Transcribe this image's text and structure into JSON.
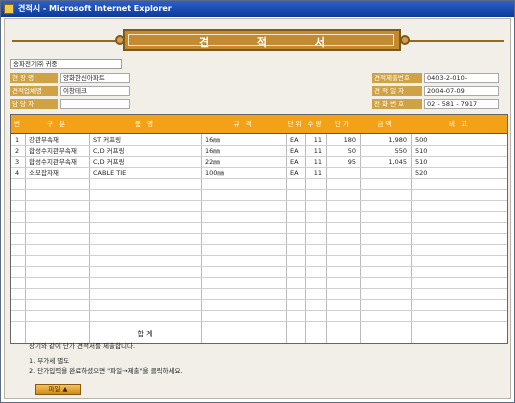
{
  "window": {
    "title": "견적시 - Microsoft Internet Explorer"
  },
  "doc": {
    "banner_title": "견 적 서",
    "recipient": "송파전기㈜ 귀중",
    "site_label": "현 장 명",
    "site_value": "양화한신아파트",
    "company_label": "견적업체명",
    "company_value": "이창테크",
    "manager_label": "담 당 자",
    "manager_value": "",
    "submit_no_label": "견적제출번호",
    "submit_no_value": "0403-2-010-",
    "date_label": "견 적 일 자",
    "date_value": "2004-07-09",
    "phone_label": "전 화 번 호",
    "phone_value": "02  - 581  - 7917"
  },
  "table": {
    "headers": [
      "번호",
      "구    분",
      "품        명",
      "규    격",
      "단위",
      "수량",
      "단가",
      "금액",
      "비    고"
    ],
    "rows": [
      {
        "no": "1",
        "category": "강관부속재",
        "item": "ST 커프링",
        "spec": "16㎜",
        "unit": "EA",
        "qty": "11",
        "price": "180",
        "amount": "1,980",
        "note": "500"
      },
      {
        "no": "2",
        "category": "합성수지관부속재",
        "item": "C,D 커프링",
        "spec": "16㎜",
        "unit": "EA",
        "qty": "11",
        "price": "50",
        "amount": "550",
        "note": "510"
      },
      {
        "no": "3",
        "category": "합성수지관부속재",
        "item": "C,D 커프링",
        "spec": "22㎜",
        "unit": "EA",
        "qty": "11",
        "price": "95",
        "amount": "1,045",
        "note": "510"
      },
      {
        "no": "4",
        "category": "소모잡자재",
        "item": "CABLE TIE",
        "spec": "100㎜",
        "unit": "EA",
        "qty": "11",
        "price": "",
        "amount": "",
        "note": "520"
      }
    ],
    "sum_label": "합      계"
  },
  "notes": {
    "line1": "상기와 같이 단가 견적서를 제출합니다.",
    "line2": "1. 부가세 별도",
    "line3": "2. 단가입력을 완료하셨으면 \"파일→제출\"을 클릭하세요."
  },
  "file_button": {
    "label": "파일 ▲"
  }
}
